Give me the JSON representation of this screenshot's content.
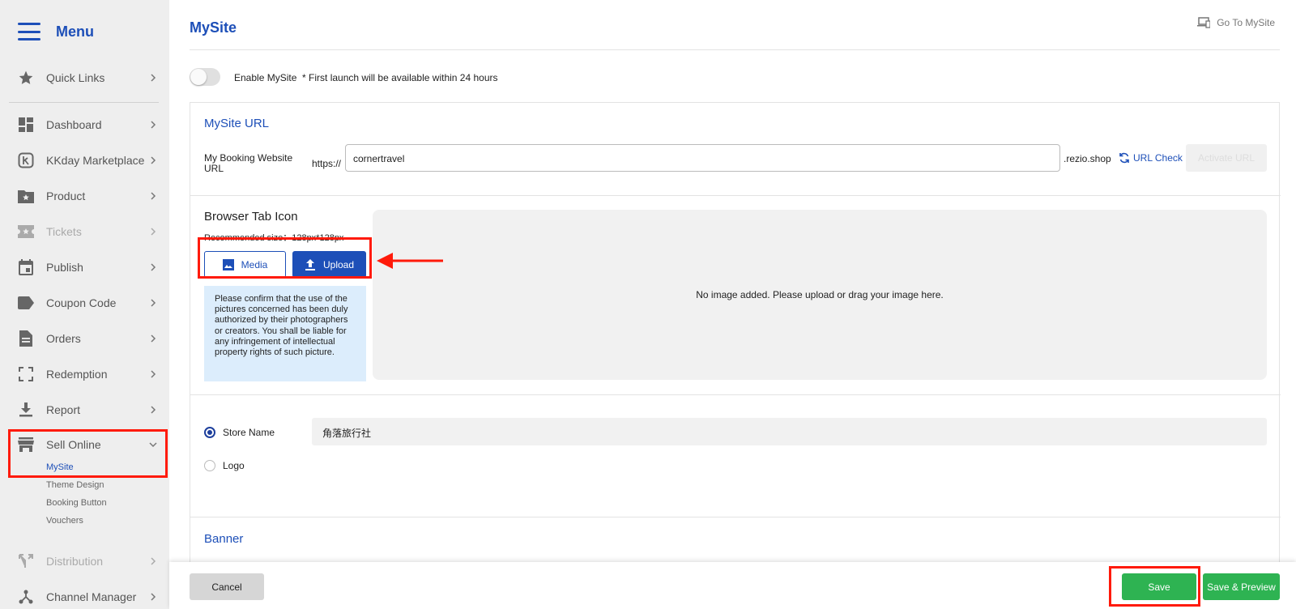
{
  "sidebar": {
    "menu_title": "Menu",
    "items": [
      {
        "label": "Quick Links",
        "icon": "star-icon"
      },
      {
        "label": "Dashboard",
        "icon": "dashboard-icon"
      },
      {
        "label": "KKday Marketplace",
        "icon": "kkday-icon"
      },
      {
        "label": "Product",
        "icon": "product-folder-icon"
      },
      {
        "label": "Tickets",
        "icon": "ticket-icon"
      },
      {
        "label": "Publish",
        "icon": "calendar-icon"
      },
      {
        "label": "Coupon Code",
        "icon": "tag-icon"
      },
      {
        "label": "Orders",
        "icon": "document-icon"
      },
      {
        "label": "Redemption",
        "icon": "scan-icon"
      },
      {
        "label": "Report",
        "icon": "download-icon"
      },
      {
        "label": "Sell Online",
        "icon": "store-icon"
      },
      {
        "label": "Distribution",
        "icon": "split-icon"
      },
      {
        "label": "Channel Manager",
        "icon": "network-icon"
      }
    ],
    "sub_items": [
      "MySite",
      "Theme Design",
      "Booking Button",
      "Vouchers"
    ]
  },
  "header": {
    "title": "MySite",
    "go_to_label": "Go To MySite"
  },
  "enable": {
    "label": "Enable MySite  * First launch will be available within 24 hours",
    "enabled": false
  },
  "url_section": {
    "title": "MySite URL",
    "label": "My Booking Website URL",
    "prefix": "https://",
    "value": "cornertravel",
    "suffix": ".rezio.shop",
    "check_label": "URL Check",
    "activate_label": "Activate URL"
  },
  "icon_section": {
    "title": "Browser Tab Icon",
    "recommended": "Recommended size：128px*128px",
    "media_label": "Media",
    "upload_label": "Upload",
    "notice": "Please confirm that the use of the pictures concerned has been duly authorized by their photographers or creators. You shall be liable for any infringement of intellectual property rights of such picture.",
    "dropzone_text": "No image added. Please upload or drag your image here."
  },
  "brand_section": {
    "store_name_label": "Store Name",
    "store_name_value": "角落旅行社",
    "logo_label": "Logo",
    "selected": "Store Name"
  },
  "banner_section": {
    "title": "Banner"
  },
  "footer": {
    "cancel_label": "Cancel",
    "save_label": "Save",
    "save_preview_label": "Save & Preview"
  },
  "colors": {
    "primary": "#1d4fb8",
    "save_green": "#2eb352",
    "highlight_red": "#ff1a0a"
  }
}
